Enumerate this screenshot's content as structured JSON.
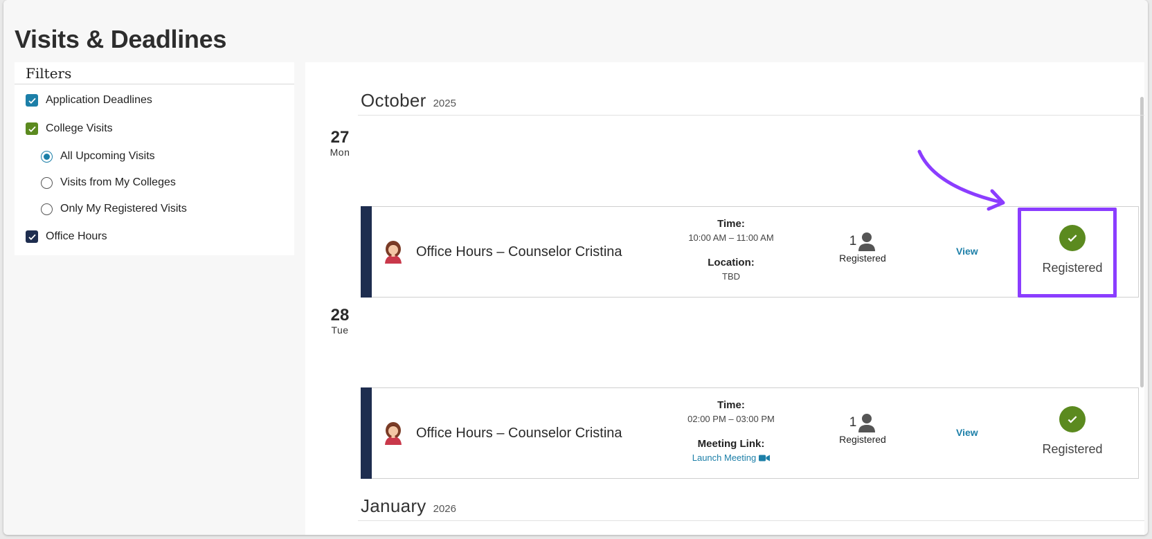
{
  "page": {
    "title": "Visits & Deadlines"
  },
  "filters": {
    "title": "Filters",
    "checkboxes": [
      {
        "label": "Application Deadlines",
        "checked": true,
        "color": "#1c7fa8"
      },
      {
        "label": "College Visits",
        "checked": true,
        "color": "#5b8a1f"
      },
      {
        "label": "Office Hours",
        "checked": true,
        "color": "#1e2d4f"
      }
    ],
    "visit_options": [
      {
        "label": "All Upcoming Visits",
        "selected": true
      },
      {
        "label": "Visits from My Colleges",
        "selected": false
      },
      {
        "label": "Only My Registered Visits",
        "selected": false
      }
    ]
  },
  "months": [
    {
      "name": "October",
      "year": "2025"
    },
    {
      "name": "January",
      "year": "2026"
    }
  ],
  "days": [
    {
      "num": "27",
      "dow": "Mon"
    },
    {
      "num": "28",
      "dow": "Tue"
    }
  ],
  "events": [
    {
      "title": "Office Hours – Counselor Cristina",
      "time_label": "Time:",
      "time_value": "10:00 AM – 11:00 AM",
      "detail_label": "Location:",
      "detail_value": "TBD",
      "count": "1",
      "count_label": "Registered",
      "view_label": "View",
      "status_label": "Registered"
    },
    {
      "title": "Office Hours – Counselor Cristina",
      "time_label": "Time:",
      "time_value": "02:00 PM – 03:00 PM",
      "detail_label": "Meeting Link:",
      "detail_value": "Launch Meeting",
      "count": "1",
      "count_label": "Registered",
      "view_label": "View",
      "status_label": "Registered"
    }
  ],
  "colors": {
    "accent_blue": "#1c7fa8",
    "accent_green": "#5b8a1f",
    "navy": "#1e2d4f",
    "annotation_purple": "#8b3dff"
  }
}
